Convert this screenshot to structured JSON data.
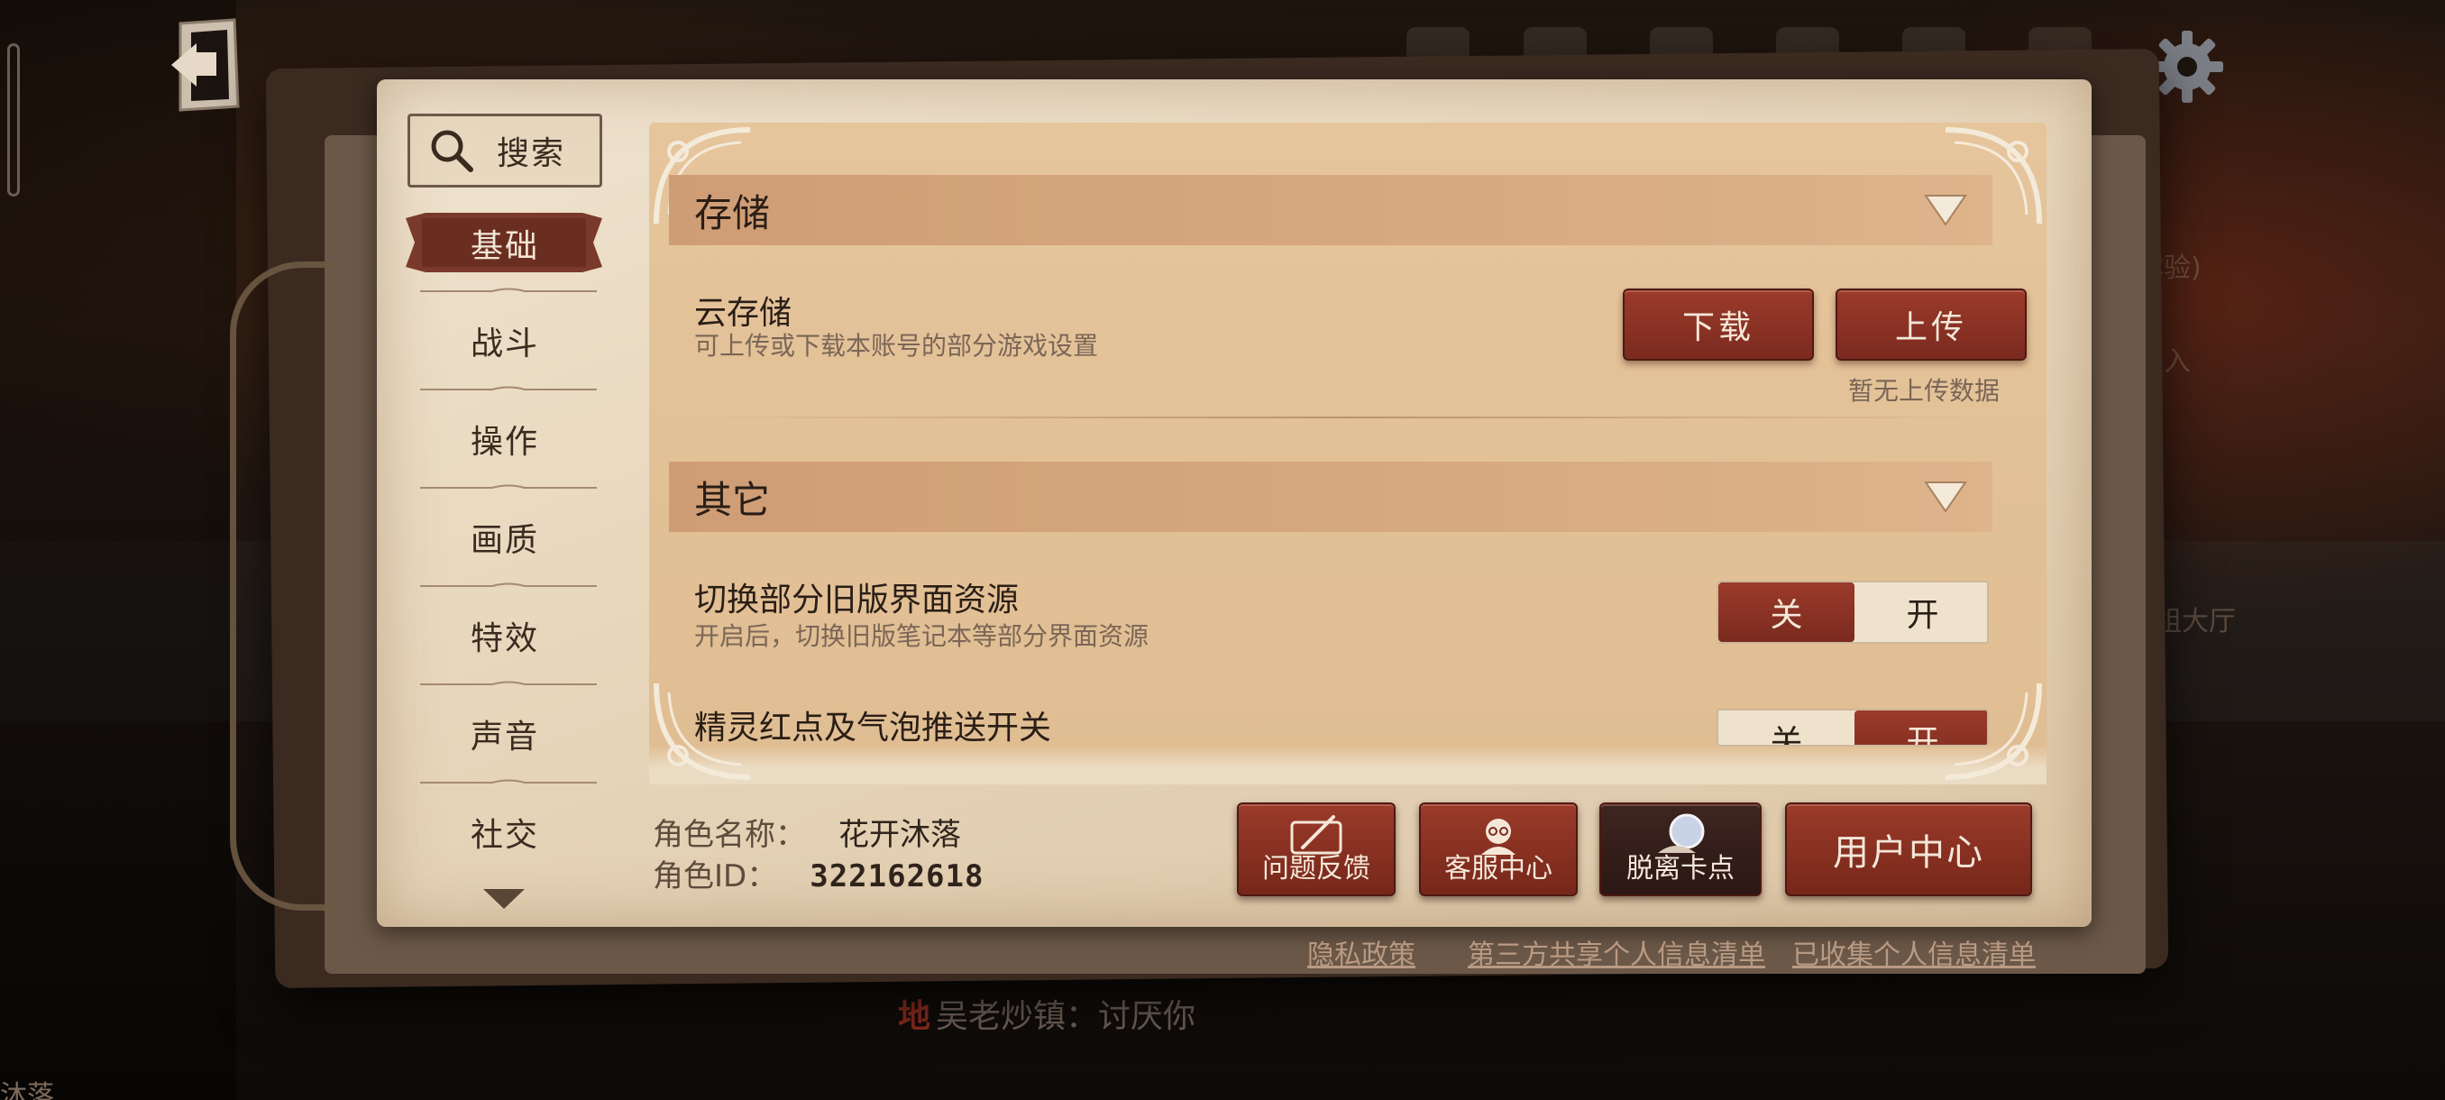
{
  "background": {
    "partial_text_1": "体验)",
    "partial_text_2": "进入",
    "partial_text_3": "组大厅",
    "chat": {
      "channel": "地",
      "message": "吴老炒镇：讨厌你"
    },
    "bottom_left_text": "沐落"
  },
  "sidebar": {
    "search_label": "搜索",
    "items": [
      {
        "label": "基础",
        "active": true
      },
      {
        "label": "战斗",
        "active": false
      },
      {
        "label": "操作",
        "active": false
      },
      {
        "label": "画质",
        "active": false
      },
      {
        "label": "特效",
        "active": false
      },
      {
        "label": "声音",
        "active": false
      },
      {
        "label": "社交",
        "active": false
      }
    ]
  },
  "sections": {
    "storage": {
      "title": "存储",
      "cloud": {
        "title": "云存储",
        "description": "可上传或下载本账号的部分游戏设置",
        "download_label": "下载",
        "upload_label": "上传",
        "status": "暂无上传数据"
      }
    },
    "other": {
      "title": "其它",
      "legacy_ui": {
        "title": "切换部分旧版界面资源",
        "description": "开启后，切换旧版笔记本等部分界面资源",
        "off_label": "关",
        "on_label": "开",
        "state": "off"
      },
      "sprite_push": {
        "title": "精灵红点及气泡推送开关",
        "off_label": "关",
        "on_label": "开",
        "state": "on"
      }
    }
  },
  "footer": {
    "role_name_label": "角色名称：",
    "role_name": "花开沐落",
    "role_id_label": "角色ID：",
    "role_id": "322162618",
    "buttons": {
      "feedback": "问题反馈",
      "customer_service": "客服中心",
      "unstuck": "脱离卡点",
      "user_center": "用户中心"
    },
    "links": {
      "privacy": "隐私政策",
      "third_party": "第三方共享个人信息清单",
      "collected": "已收集个人信息清单"
    }
  },
  "colors": {
    "accent_red": "#8b3224",
    "parchment": "#efe3cf",
    "section_band": "#d4a47b",
    "text_dark": "#2a1e16"
  }
}
